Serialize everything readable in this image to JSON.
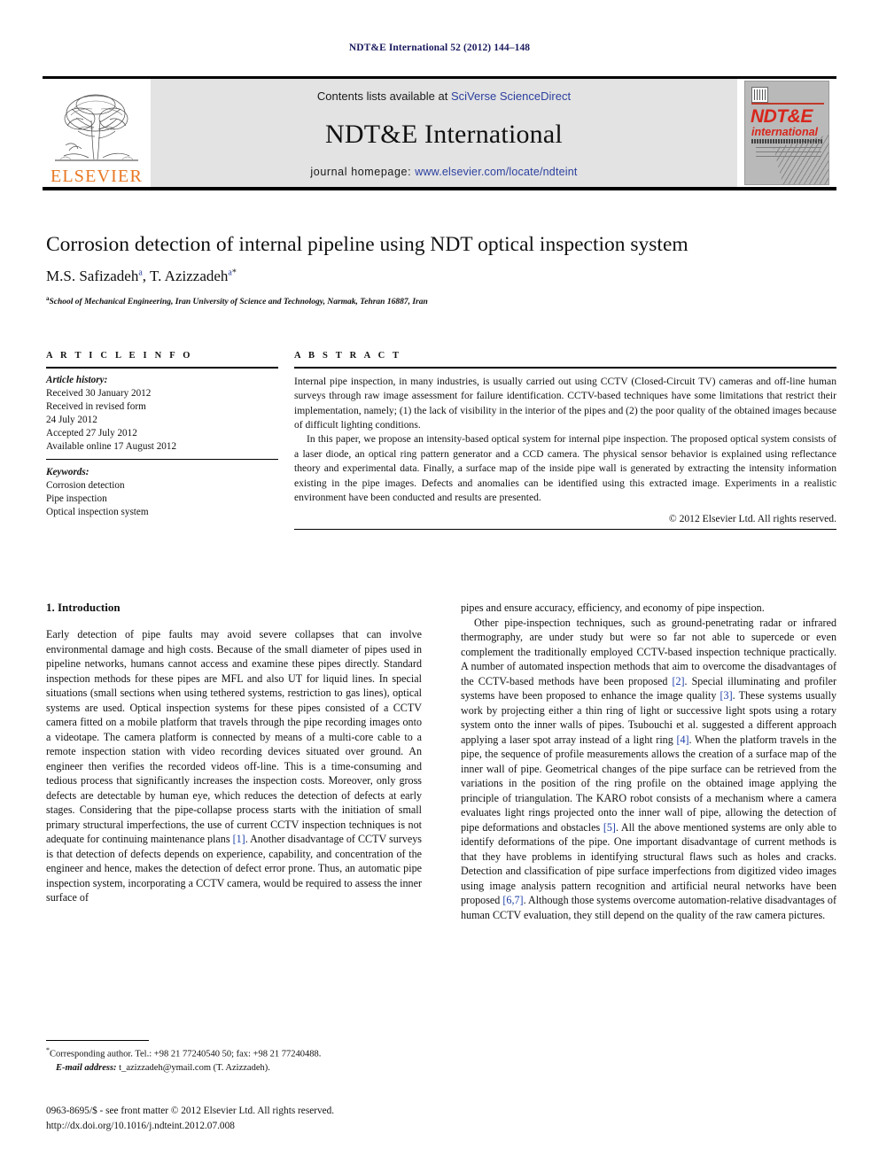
{
  "running_head": "NDT&E International 52 (2012) 144–148",
  "masthead": {
    "contents_prefix": "Contents lists available at ",
    "contents_link": "SciVerse ScienceDirect",
    "journal_title": "NDT&E International",
    "homepage_prefix": "journal homepage: ",
    "homepage_url": "www.elsevier.com/locate/ndteint",
    "publisher_wordmark": "ELSEVIER",
    "cover": {
      "title_main": "NDT&E",
      "title_sub": "international",
      "background_color": "#b9b9b9",
      "title_color": "#d8261c"
    },
    "link_color": "#2b3f9e",
    "band_color": "#e3e3e3"
  },
  "title": "Corrosion detection of internal pipeline using NDT optical inspection system",
  "authors": [
    {
      "name": "M.S. Safizadeh",
      "marks": "a",
      "star": false
    },
    {
      "name": "T. Azizzadeh",
      "marks": "a",
      "star": true
    }
  ],
  "authors_line_sep": ", ",
  "affiliation": {
    "mark": "a",
    "text": "School of Mechanical Engineering, Iran University of Science and Technology, Narmak, Tehran 16887, Iran"
  },
  "article_info": {
    "heading": "A R T I C L E   I N F O",
    "history_label": "Article history:",
    "history": [
      "Received 30 January 2012",
      "Received in revised form",
      "24 July 2012",
      "Accepted 27 July 2012",
      "Available online 17 August 2012"
    ],
    "keywords_label": "Keywords:",
    "keywords": [
      "Corrosion detection",
      "Pipe inspection",
      "Optical inspection system"
    ]
  },
  "abstract": {
    "heading": "A B S T R A C T",
    "paragraphs": [
      "Internal pipe inspection, in many industries, is usually carried out using CCTV (Closed-Circuit TV) cameras and off-line human surveys through raw image assessment for failure identification. CCTV-based techniques have some limitations that restrict their implementation, namely; (1) the lack of visibility in the interior of the pipes and (2) the poor quality of the obtained images because of difficult lighting conditions.",
      "In this paper, we propose an intensity-based optical system for internal pipe inspection. The proposed optical system consists of a laser diode, an optical ring pattern generator and a CCD camera. The physical sensor behavior is explained using reflectance theory and experimental data. Finally, a surface map of the inside pipe wall is generated by extracting the intensity information existing in the pipe images. Defects and anomalies can be identified using this extracted image. Experiments in a realistic environment have been conducted and results are presented."
    ],
    "copyright": "© 2012 Elsevier Ltd. All rights reserved."
  },
  "body": {
    "section_number_title": "1.  Introduction",
    "left_paragraphs": [
      "Early detection of pipe faults may avoid severe collapses that can involve environmental damage and high costs. Because of the small diameter of pipes used in pipeline networks, humans cannot access and examine these pipes directly. Standard inspection methods for these pipes are MFL and also UT for liquid lines. In special situations (small sections when using tethered systems, restriction to gas lines), optical systems are used. Optical inspection systems for these pipes consisted of a CCTV camera fitted on a mobile platform that travels through the pipe recording images onto a videotape. The camera platform is connected by means of a multi-core cable to a remote inspection station with video recording devices situated over ground. An engineer then verifies the recorded videos off-line. This is a time-consuming and tedious process that significantly increases the inspection costs. Moreover, only gross defects are detectable by human eye, which reduces the detection of defects at early stages. Considering that the pipe-collapse process starts with the initiation of small primary structural imperfections, the use of current CCTV inspection techniques is not adequate for continuing maintenance plans [1]. Another disadvantage of CCTV surveys is that detection of defects depends on experience, capability, and concentration of the engineer and hence, makes the detection of defect error prone. Thus, an automatic pipe inspection system, incorporating a CCTV camera, would be required to assess the inner surface of"
    ],
    "right_paragraphs": [
      "pipes and ensure accuracy, efficiency, and economy of pipe inspection.",
      "Other pipe-inspection techniques, such as ground-penetrating radar or infrared thermography, are under study but were so far not able to supercede or even complement the traditionally employed CCTV-based inspection technique practically. A number of automated inspection methods that aim to overcome the disadvantages of the CCTV-based methods have been proposed [2]. Special illuminating and profiler systems have been proposed to enhance the image quality [3]. These systems usually work by projecting either a thin ring of light or successive light spots using a rotary system onto the inner walls of pipes. Tsubouchi et al. suggested a different approach applying a laser spot array instead of a light ring [4]. When the platform travels in the pipe, the sequence of profile measurements allows the creation of a surface map of the inner wall of pipe. Geometrical changes of the pipe surface can be retrieved from the variations in the position of the ring profile on the obtained image applying the principle of triangulation. The KARO robot consists of a mechanism where a camera evaluates light rings projected onto the inner wall of pipe, allowing the detection of pipe deformations and obstacles [5]. All the above mentioned systems are only able to identify deformations of the pipe. One important disadvantage of current methods is that they have problems in identifying structural flaws such as holes and cracks. Detection and classification of pipe surface imperfections from digitized video images using image analysis pattern recognition and artificial neural networks have been proposed [6,7]. Although those systems overcome automation-relative disadvantages of human CCTV evaluation, they still depend on the quality of the raw camera pictures."
    ],
    "reference_color": "#1f3fa8"
  },
  "footnote": {
    "star": "*",
    "corresponding": "Corresponding author. Tel.: +98 21 77240540 50; fax: +98 21 77240488.",
    "email_label": "E-mail address:",
    "email_value": "t_azizzadeh@ymail.com (T. Azizzadeh)."
  },
  "imprint": {
    "issn_line": "0963-8695/$ - see front matter © 2012 Elsevier Ltd. All rights reserved.",
    "doi_line": "http://dx.doi.org/10.1016/j.ndteint.2012.07.008"
  }
}
